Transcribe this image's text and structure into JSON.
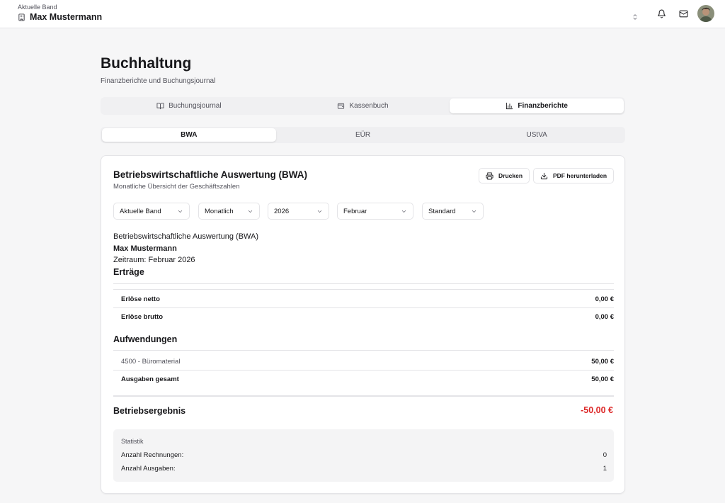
{
  "topbar": {
    "band_label": "Aktuelle Band",
    "band_name": "Max Mustermann",
    "icons": [
      "building-icon",
      "chevrons-up-down-icon",
      "bell-icon",
      "mail-icon"
    ]
  },
  "page": {
    "title": "Buchhaltung",
    "subtitle": "Finanzberichte und Buchungsjournal"
  },
  "main_tabs": [
    {
      "label": "Buchungsjournal",
      "icon": "book-open-icon",
      "active": false
    },
    {
      "label": "Kassenbuch",
      "icon": "wallet-icon",
      "active": false
    },
    {
      "label": "Finanzberichte",
      "icon": "bar-chart-icon",
      "active": true
    }
  ],
  "sub_tabs": [
    {
      "label": "BWA",
      "active": true
    },
    {
      "label": "EÜR",
      "active": false
    },
    {
      "label": "UStVA",
      "active": false
    }
  ],
  "card": {
    "title": "Betriebswirtschaftliche Auswertung (BWA)",
    "subtitle": "Monatliche Übersicht der Geschäftszahlen",
    "print_label": "Drucken",
    "download_label": "PDF herunterladen"
  },
  "filters": {
    "band": "Aktuelle Band",
    "period_type": "Monatlich",
    "year": "2026",
    "month": "Februar",
    "layout": "Standard"
  },
  "report": {
    "heading": "Betriebswirtschaftliche Auswertung (BWA)",
    "name": "Max Mustermann",
    "period": "Zeitraum: Februar 2026",
    "revenue_title": "Erträge",
    "revenue_net_label": "Erlöse netto",
    "revenue_net_value": "0,00 €",
    "revenue_gross_label": "Erlöse brutto",
    "revenue_gross_value": "0,00 €",
    "expenses_title": "Aufwendungen",
    "expense_account_label": "4500 - Büromaterial",
    "expense_account_value": "50,00 €",
    "expenses_total_label": "Ausgaben gesamt",
    "expenses_total_value": "50,00 €",
    "result_label": "Betriebsergebnis",
    "result_value": "-50,00 €"
  },
  "stats": {
    "title": "Statistik",
    "invoices_label": "Anzahl Rechnungen:",
    "invoices_value": "0",
    "expenses_label": "Anzahl Ausgaben:",
    "expenses_value": "1"
  },
  "colors": {
    "negative": "#dc2626",
    "border": "#e4e4e7",
    "muted_text": "#52525b"
  }
}
